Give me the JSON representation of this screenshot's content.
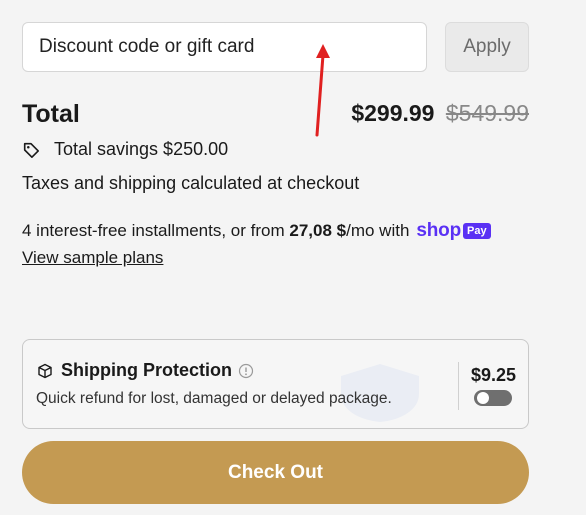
{
  "discount": {
    "placeholder": "Discount code or gift card",
    "value": "",
    "apply_label": "Apply"
  },
  "summary": {
    "total_label": "Total",
    "price_current": "$299.99",
    "price_original": "$549.99",
    "savings_text": "Total savings $250.00",
    "savings_icon": "tag-icon",
    "taxes_text": "Taxes and shipping calculated at checkout"
  },
  "installments": {
    "text_before": "4 interest-free installments, or from ",
    "amount": "27,08 $",
    "text_after": "/mo with",
    "provider_logo": "shop",
    "provider_badge": "Pay",
    "link_label": "View sample plans",
    "brand_color": "#5a31f4"
  },
  "shipping_protection": {
    "title": "Shipping Protection",
    "description": "Quick refund for lost, damaged or delayed package.",
    "price": "$9.25",
    "enabled": false,
    "icons": [
      "box-icon",
      "info-icon"
    ]
  },
  "checkout": {
    "label": "Check Out",
    "color": "#c49a52"
  },
  "annotation": {
    "type": "red-arrow",
    "color": "#e02020"
  }
}
